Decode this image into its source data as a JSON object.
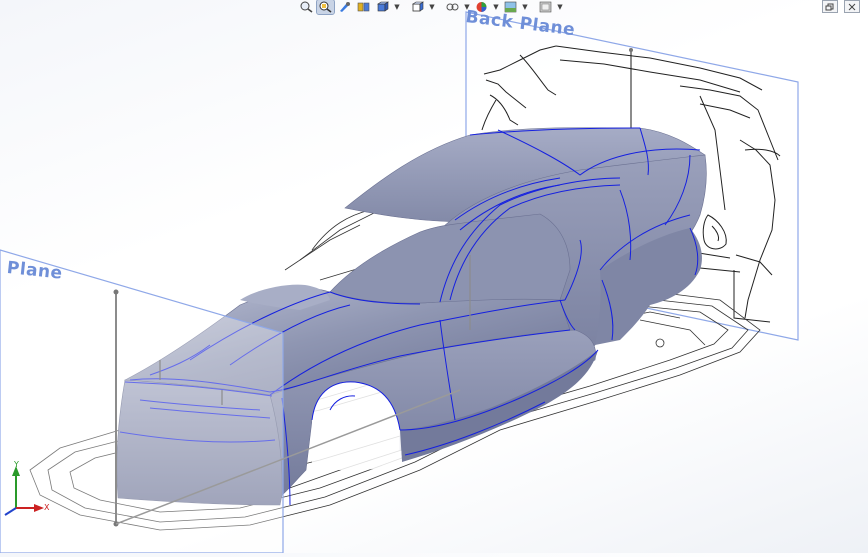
{
  "viewport": {
    "planes": {
      "back": "Back Plane",
      "front": "Plane"
    },
    "triad": {
      "x_label": "X",
      "y_label": "Y"
    },
    "model": "car-body-surface"
  },
  "toolbar": {
    "icons": [
      "zoom-to-fit-icon",
      "zoom-area-icon",
      "previous-view-icon",
      "section-view-icon",
      "view-orientation-icon",
      "display-style-icon",
      "hide-show-items-icon",
      "edit-appearance-icon",
      "apply-scene-icon",
      "view-settings-icon"
    ],
    "active": "zoom-area-icon"
  },
  "window_controls": [
    "restore-icon",
    "close-icon"
  ],
  "colors": {
    "surface": "#8d94b0",
    "edge_lines": "#1520e0",
    "plane_label": "#6f8fd8",
    "plane_border": "#8fa8e8"
  }
}
